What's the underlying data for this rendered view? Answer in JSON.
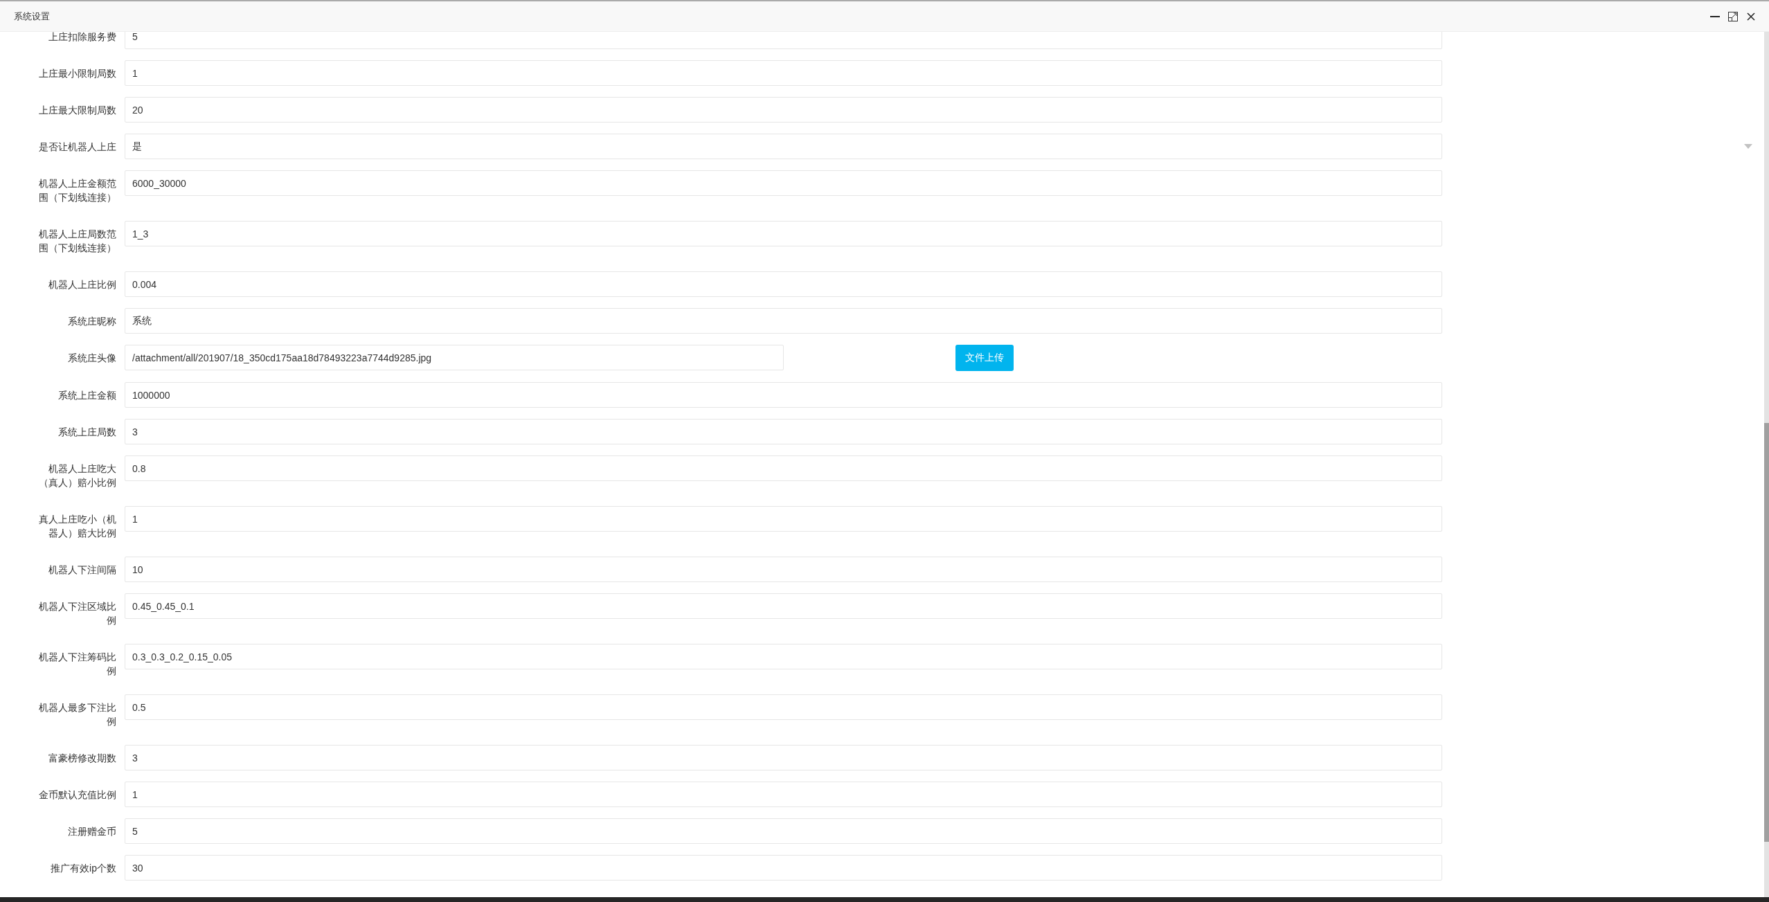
{
  "window": {
    "title": "系统设置"
  },
  "fields": [
    {
      "kind": "text",
      "label": "上庄扣除服务费",
      "value": "5"
    },
    {
      "kind": "text",
      "label": "上庄最小限制局数",
      "value": "1"
    },
    {
      "kind": "text",
      "label": "上庄最大限制局数",
      "value": "20"
    },
    {
      "kind": "select",
      "label": "是否让机器人上庄",
      "value": "是"
    },
    {
      "kind": "text",
      "label": "机器人上庄金额范围（下划线连接）",
      "value": "6000_30000"
    },
    {
      "kind": "text",
      "label": "机器人上庄局数范围（下划线连接）",
      "value": "1_3"
    },
    {
      "kind": "text",
      "label": "机器人上庄比例",
      "value": "0.004"
    },
    {
      "kind": "text",
      "label": "系统庄昵称",
      "value": "系统"
    },
    {
      "kind": "file",
      "label": "系统庄头像",
      "value": "/attachment/all/201907/18_350cd175aa18d78493223a7744d9285.jpg",
      "button": "文件上传"
    },
    {
      "kind": "text",
      "label": "系统上庄金额",
      "value": "1000000"
    },
    {
      "kind": "text",
      "label": "系统上庄局数",
      "value": "3"
    },
    {
      "kind": "text",
      "label": "机器人上庄吃大（真人）赔小比例",
      "value": "0.8"
    },
    {
      "kind": "text",
      "label": "真人上庄吃小（机器人）赔大比例",
      "value": "1"
    },
    {
      "kind": "text",
      "label": "机器人下注间隔",
      "value": "10"
    },
    {
      "kind": "text",
      "label": "机器人下注区域比例",
      "value": "0.45_0.45_0.1"
    },
    {
      "kind": "text",
      "label": "机器人下注筹码比例",
      "value": "0.3_0.3_0.2_0.15_0.05"
    },
    {
      "kind": "text",
      "label": "机器人最多下注比例",
      "value": "0.5"
    },
    {
      "kind": "text",
      "label": "富豪榜修改期数",
      "value": "3"
    },
    {
      "kind": "text",
      "label": "金币默认充值比例",
      "value": "1"
    },
    {
      "kind": "text",
      "label": "注册赠金币",
      "value": "5"
    },
    {
      "kind": "text",
      "label": "推广有效ip个数",
      "value": "30"
    }
  ]
}
